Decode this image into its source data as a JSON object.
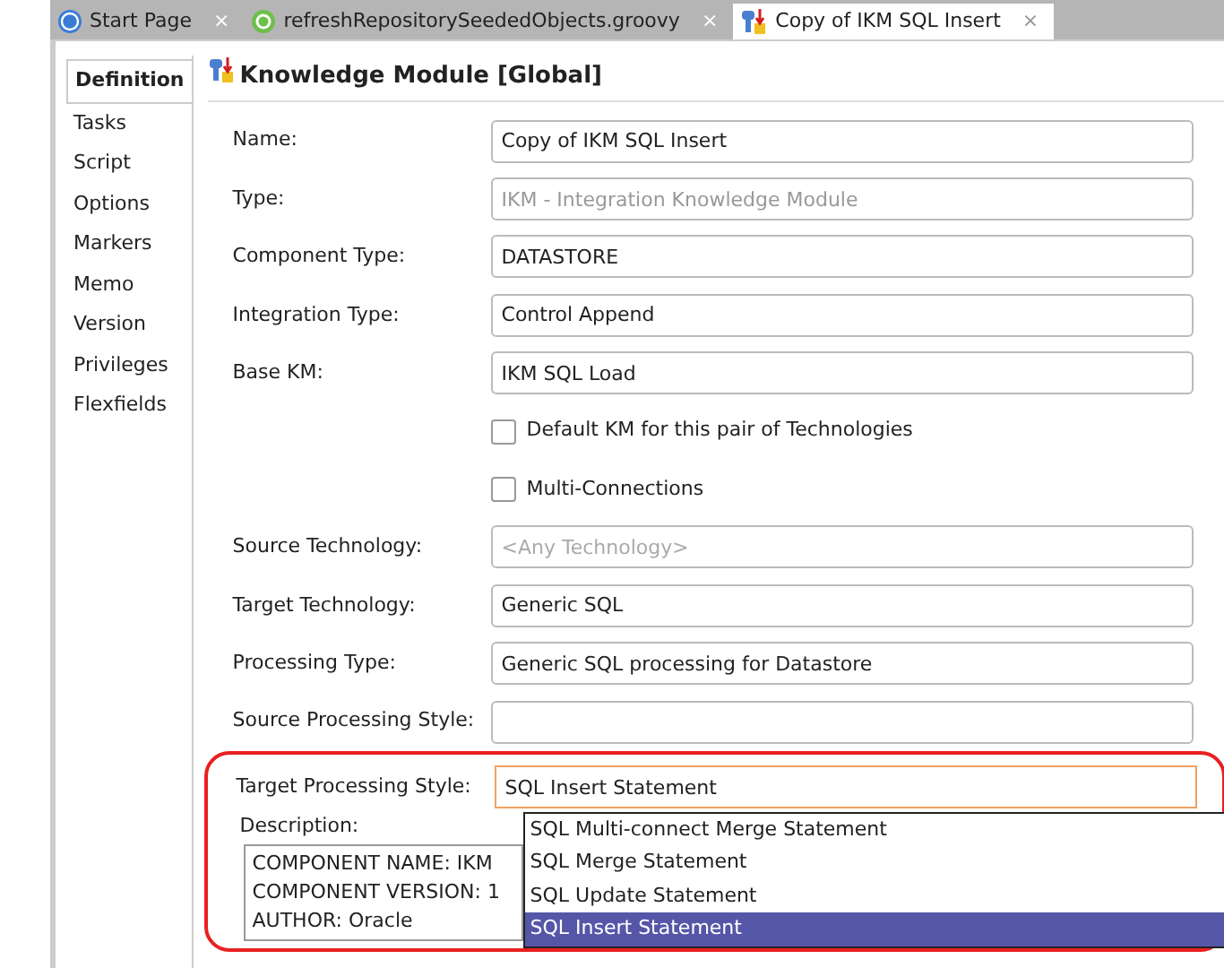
{
  "tabs": [
    {
      "label": "Start Page",
      "close": "×",
      "selected": false
    },
    {
      "label": "refreshRepositorySeededObjects.groovy",
      "close": "×",
      "selected": false
    },
    {
      "label": "Copy of IKM SQL Insert",
      "close": "×",
      "selected": true
    }
  ],
  "side_nav": [
    {
      "label": "Definition",
      "selected": true
    },
    {
      "label": "Tasks",
      "selected": false
    },
    {
      "label": "Script",
      "selected": false
    },
    {
      "label": "Options",
      "selected": false
    },
    {
      "label": "Markers",
      "selected": false
    },
    {
      "label": "Memo",
      "selected": false
    },
    {
      "label": "Version",
      "selected": false
    },
    {
      "label": "Privileges",
      "selected": false
    },
    {
      "label": "Flexfields",
      "selected": false
    }
  ],
  "title": "Knowledge Module [Global]",
  "fields": [
    {
      "kind": "text",
      "label": "Name:",
      "value": "Copy of IKM SQL Insert",
      "disabled": false
    },
    {
      "kind": "text",
      "label": "Type:",
      "value": "IKM - Integration Knowledge Module",
      "disabled": true
    },
    {
      "kind": "text",
      "label": "Component Type:",
      "value": "DATASTORE",
      "disabled": false
    },
    {
      "kind": "text",
      "label": "Integration Type:",
      "value": "Control Append",
      "disabled": false
    },
    {
      "kind": "text",
      "label": "Base KM:",
      "value": "IKM SQL Load",
      "disabled": false
    },
    {
      "kind": "checkbox",
      "label": "Default KM for this pair of Technologies",
      "checked": false
    },
    {
      "kind": "checkbox",
      "label": "Multi-Connections",
      "checked": false
    },
    {
      "kind": "text",
      "label": "Source Technology:",
      "placeholder": "<Any Technology>",
      "disabled": false
    },
    {
      "kind": "text",
      "label": "Target Technology:",
      "value": "Generic SQL",
      "disabled": false
    },
    {
      "kind": "text",
      "label": "Processing Type:",
      "value": "Generic SQL processing for Datastore",
      "disabled": false
    },
    {
      "kind": "text",
      "label": "Source Processing Style:",
      "disabled": false
    }
  ],
  "target_processing_style": {
    "label": "Target Processing Style:",
    "value": "SQL Insert Statement",
    "expanded": true,
    "options": [
      {
        "label": "SQL Multi-connect Merge Statement",
        "selected": false
      },
      {
        "label": "SQL Merge Statement",
        "selected": false
      },
      {
        "label": "SQL Update Statement",
        "selected": false
      },
      {
        "label": "SQL Insert Statement",
        "selected": true
      }
    ]
  },
  "description": {
    "label": "Description:",
    "lines": [
      "COMPONENT NAME: IKM",
      "COMPONENT VERSION: 1",
      "AUTHOR: Oracle"
    ]
  }
}
